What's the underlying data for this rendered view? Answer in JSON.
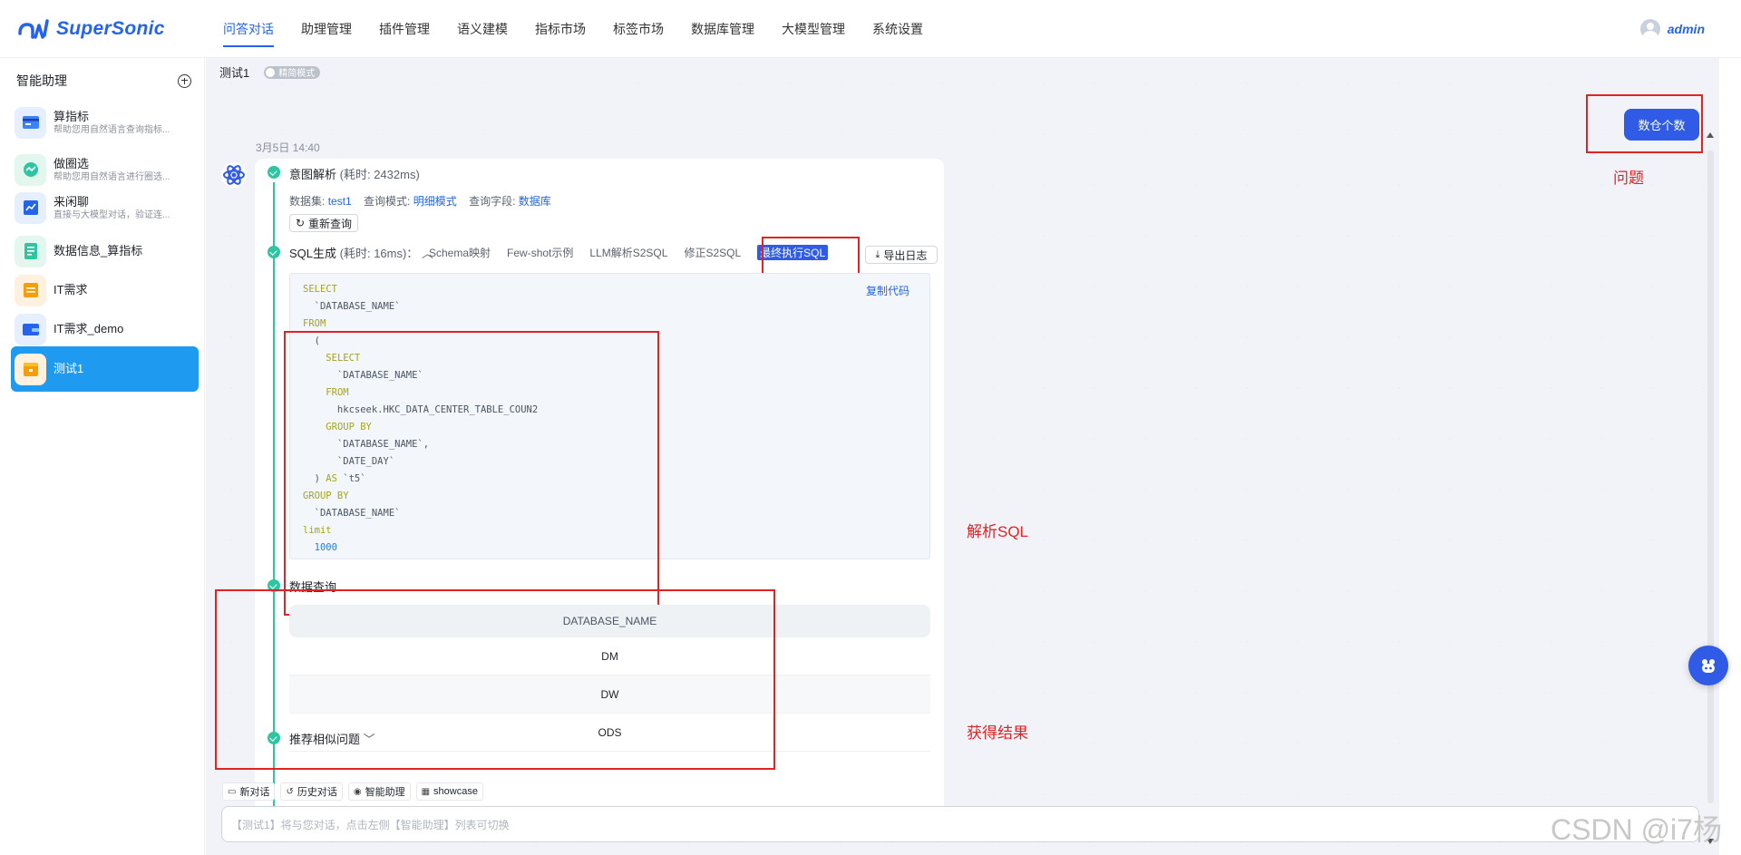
{
  "app": {
    "name": "SuperSonic",
    "user": "admin"
  },
  "nav": [
    "问答对话",
    "助理管理",
    "插件管理",
    "语义建模",
    "指标市场",
    "标签市场",
    "数据库管理",
    "大模型管理",
    "系统设置"
  ],
  "sidebar": {
    "title": "智能助理",
    "agents": [
      {
        "name": "算指标",
        "desc": "帮助您用自然语言查询指标..."
      },
      {
        "name": "做圈选",
        "desc": "帮助您用自然语言进行圈选..."
      },
      {
        "name": "来闲聊",
        "desc": "直接与大模型对话，验证连..."
      },
      {
        "name": "数据信息_算指标",
        "desc": ""
      },
      {
        "name": "IT需求",
        "desc": ""
      },
      {
        "name": "IT需求_demo",
        "desc": ""
      },
      {
        "name": "测试1",
        "desc": ""
      }
    ]
  },
  "conversation": {
    "title": "测试1",
    "mode_toggle": "精简模式",
    "timestamp": "3月5日 14:40",
    "question": "数仓个数"
  },
  "intent": {
    "title": "意图解析",
    "cost": "(耗时: 2432ms)",
    "dataset_label": "数据集:",
    "dataset": "test1",
    "mode_label": "查询模式:",
    "mode": "明细模式",
    "field_label": "查询字段:",
    "field": "数据库",
    "requery": "重新查询"
  },
  "sql": {
    "title": "SQL生成",
    "cost": "(耗时: 16ms)：",
    "tabs": [
      "Schema映射",
      "Few-shot示例",
      "LLM解析S2SQL",
      "修正S2SQL",
      "最终执行SQL"
    ],
    "export": "导出日志",
    "copy": "复制代码",
    "code_lines": [
      "SELECT",
      "  `DATABASE_NAME`",
      "FROM",
      "  (",
      "    SELECT",
      "      `DATABASE_NAME`",
      "    FROM",
      "      hkcseek.HKC_DATA_CENTER_TABLE_COUN2",
      "    GROUP BY",
      "      `DATABASE_NAME`,",
      "      `DATE_DAY`",
      "  ) AS `t5`",
      "GROUP BY",
      "  `DATABASE_NAME`",
      "limit",
      "  1000"
    ]
  },
  "data_query": {
    "title": "数据查询",
    "column": "DATABASE_NAME",
    "rows": [
      "DM",
      "DW",
      "ODS"
    ]
  },
  "recommend": "推荐相似问题",
  "annotations": {
    "question": "问题",
    "sql": "解析SQL",
    "result": "获得结果"
  },
  "input": {
    "quick_actions": [
      "新对话",
      "历史对话",
      "智能助理",
      "showcase"
    ],
    "placeholder": "【测试1】将与您对话，点击左侧【智能助理】列表可切换"
  },
  "watermark": "CSDN @i7杨",
  "colors": {
    "primary": "#2563eb",
    "accent_blue": "#2f5be6",
    "success": "#2fc4a2",
    "annotation_red": "#e02424",
    "active_agent": "#1e9bf0"
  }
}
